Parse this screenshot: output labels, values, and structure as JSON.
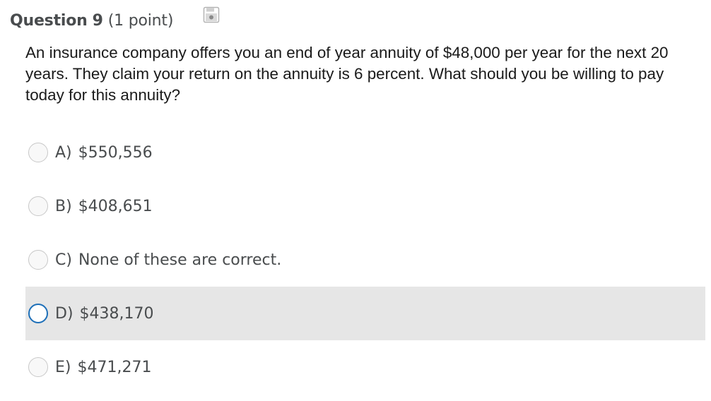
{
  "question": {
    "label": "Question",
    "number": "9",
    "points": "(1 point)",
    "save_icon": "floppy-disk-icon",
    "text": "An insurance company offers you an end of year annuity of $48,000 per year for the next 20 years. They claim your return on the annuity is 6 percent. What should you be willing to pay today for this annuity?"
  },
  "options": [
    {
      "letter": "A)",
      "value": "$550,556",
      "selected": false,
      "hovered": false
    },
    {
      "letter": "B)",
      "value": "$408,651",
      "selected": false,
      "hovered": false
    },
    {
      "letter": "C)",
      "value": "None of these are correct.",
      "selected": false,
      "hovered": false
    },
    {
      "letter": "D)",
      "value": "$438,170",
      "selected": false,
      "hovered": true
    },
    {
      "letter": "E)",
      "value": "$471,271",
      "selected": false,
      "hovered": false
    }
  ],
  "colors": {
    "hover_background": "#e6e6e6",
    "radio_focus_border": "#1d6fb8",
    "header_text": "#494c4e"
  }
}
